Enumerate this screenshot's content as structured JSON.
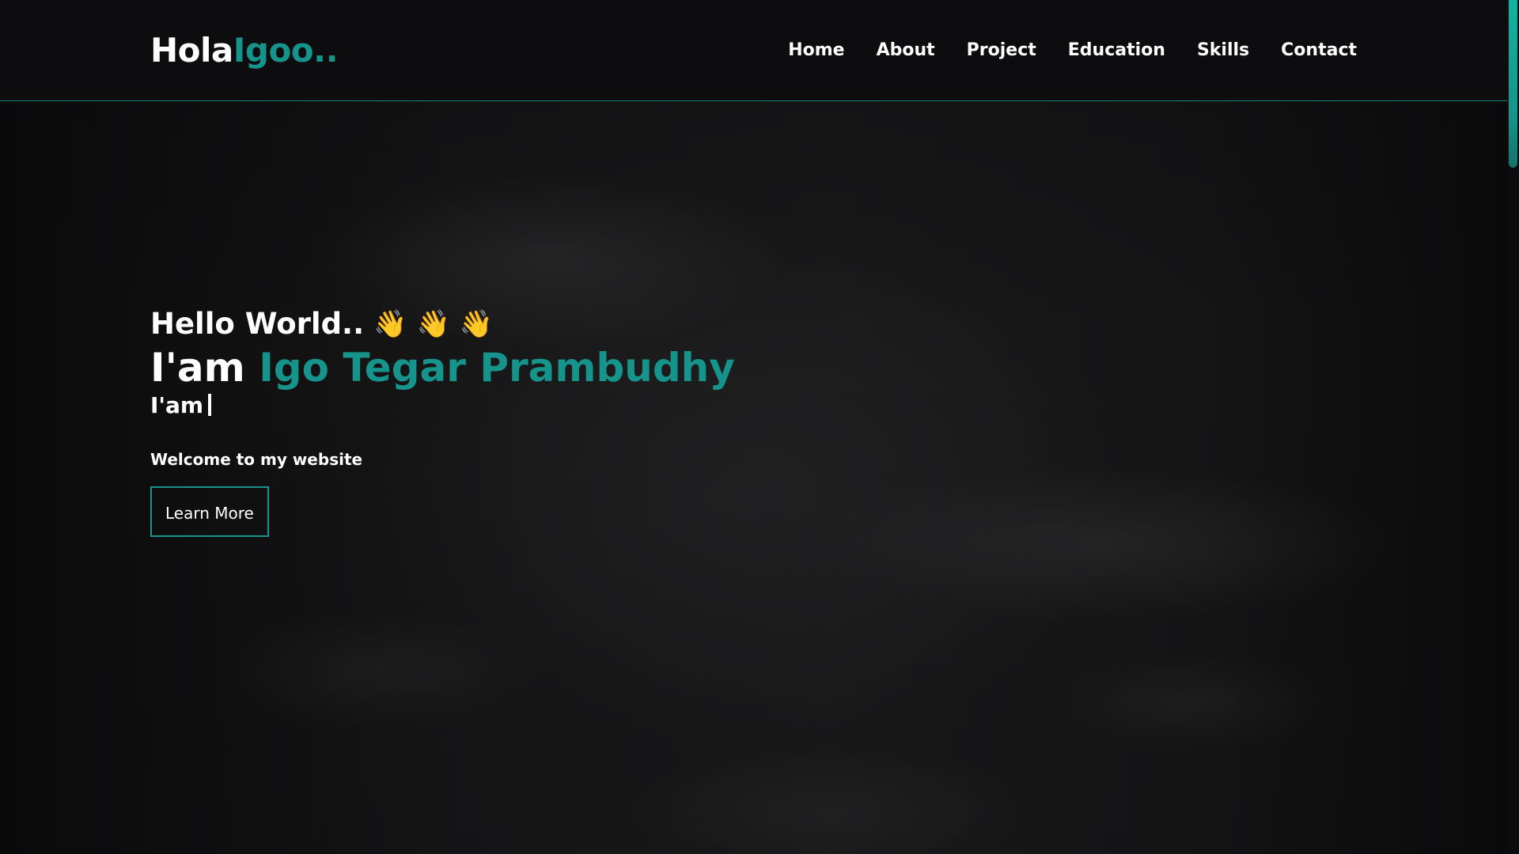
{
  "logo": {
    "prefix": "Hola",
    "accent": "Igoo..",
    "accent_color": "#16938a"
  },
  "nav": {
    "items": [
      {
        "label": "Home"
      },
      {
        "label": "About"
      },
      {
        "label": "Project"
      },
      {
        "label": "Education"
      },
      {
        "label": "Skills"
      },
      {
        "label": "Contact"
      }
    ]
  },
  "hero": {
    "greeting": "Hello World..",
    "wave_icon": "waving-hand-icon",
    "wave_glyph": "👋",
    "name_prefix": "I'am",
    "name": "Igo Tegar Prambudhy",
    "typed_prefix": "I'am",
    "welcome": "Welcome to my website",
    "button_label": "Learn More"
  },
  "colors": {
    "accent": "#16938a",
    "background": "#0b0b0d",
    "text": "#ffffff"
  }
}
